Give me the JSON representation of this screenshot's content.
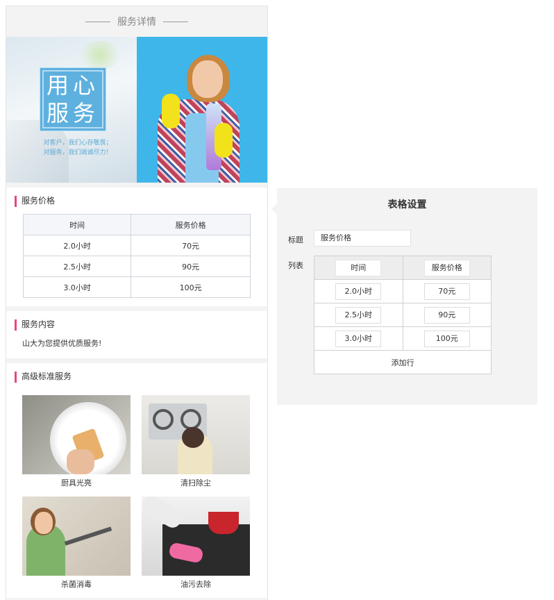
{
  "header": {
    "title": "服务详情"
  },
  "banner": {
    "slogan_line1": "用心",
    "slogan_line2": "服务",
    "sub_line1": "对客户，我们心存敬畏；",
    "sub_line2": "对服务，我们竭诚尽力！"
  },
  "price_section": {
    "title": "服务价格",
    "columns": [
      "时间",
      "服务价格"
    ],
    "rows": [
      {
        "time": "2.0小时",
        "price": "70元"
      },
      {
        "time": "2.5小时",
        "price": "90元"
      },
      {
        "time": "3.0小时",
        "price": "100元"
      }
    ]
  },
  "content_section": {
    "title": "服务内容",
    "text": "山大为您提供优质服务!"
  },
  "premium_section": {
    "title": "高级标准服务",
    "items": [
      {
        "label": "厨具光亮",
        "icon": "kitchenware-photo"
      },
      {
        "label": "清扫除尘",
        "icon": "stove-cleaning-photo"
      },
      {
        "label": "杀菌消毒",
        "icon": "steam-disinfect-photo"
      },
      {
        "label": "油污去除",
        "icon": "grease-removal-photo"
      }
    ]
  },
  "settings": {
    "title": "表格设置",
    "title_label": "标题",
    "title_value": "服务价格",
    "list_label": "列表",
    "columns": [
      "时间",
      "服务价格"
    ],
    "rows": [
      {
        "time": "2.0小时",
        "price": "70元"
      },
      {
        "time": "2.5小时",
        "price": "90元"
      },
      {
        "time": "3.0小时",
        "price": "100元"
      }
    ],
    "add_row_label": "添加行"
  },
  "colors": {
    "accent_bar": "#e9447f",
    "banner_blue": "#3fb6ea",
    "panel_bg": "#f3f3f3"
  }
}
